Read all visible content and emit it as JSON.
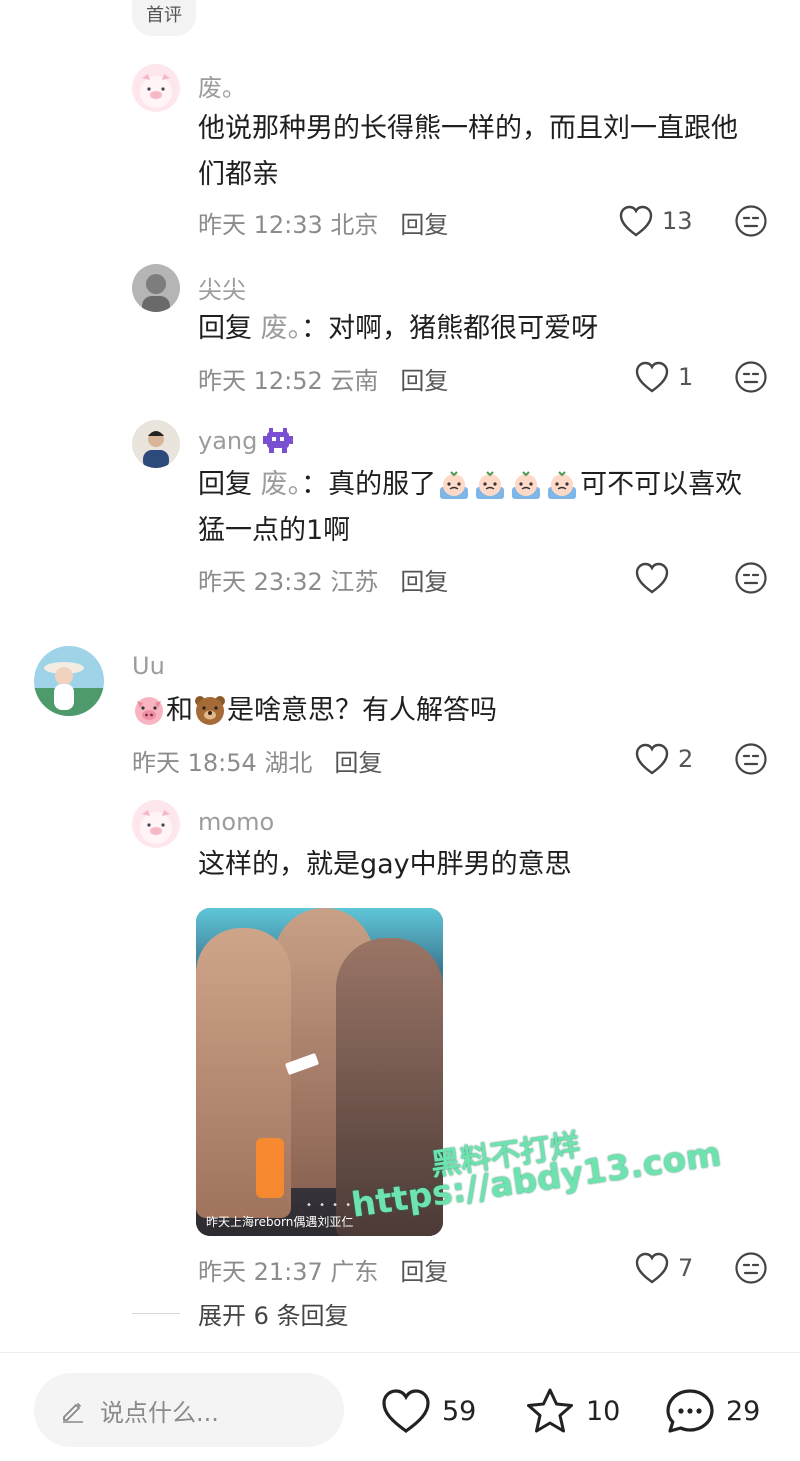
{
  "top_chip": "首评",
  "comments": [
    {
      "username": "废。",
      "text": "他说那种男的长得熊一样的，而且刘一直跟他们都亲",
      "text_line1": "他说那种男的长得熊一样的，而且刘一直跟他",
      "text_line2": "们都亲",
      "time": "昨天 12:33 北京",
      "reply_label": "回复",
      "likes": "13"
    },
    {
      "username": "尖尖",
      "reply_prefix": "回复 ",
      "reply_to": "废。",
      "text": "：对啊，猪熊都很可爱呀",
      "time": "昨天 12:52 云南",
      "reply_label": "回复",
      "likes": "1"
    },
    {
      "username": "yang",
      "reply_prefix": "回复 ",
      "reply_to": "废。",
      "text_a": "：真的服了",
      "text_b": "可不可以喜欢",
      "text_line2": "猛一点的1啊",
      "time": "昨天 23:32 江苏",
      "reply_label": "回复",
      "likes": ""
    },
    {
      "username": "Uu",
      "text_mid": "和",
      "text_end": "是啥意思？有人解答吗",
      "time": "昨天 18:54 湖北",
      "reply_label": "回复",
      "likes": "2"
    },
    {
      "username": "momo",
      "text": "这样的，就是gay中胖男的意思",
      "photo_caption": "昨天上海reborn偶遇刘亚仁",
      "photo_dots": "• • • •",
      "time": "昨天 21:37 广东",
      "reply_label": "回复",
      "likes": "7"
    }
  ],
  "expand_label": "展开 6 条回复",
  "watermark": {
    "line1": "黑料不打烊",
    "line2": "https://abdy13.com"
  },
  "bottom_bar": {
    "input_placeholder": "说点什么...",
    "likes": "59",
    "stars": "10",
    "comments": "29"
  },
  "colors": {
    "meta": "#8c8c8c",
    "username": "#9c9c9c",
    "watermark": "#6ee3b0"
  }
}
